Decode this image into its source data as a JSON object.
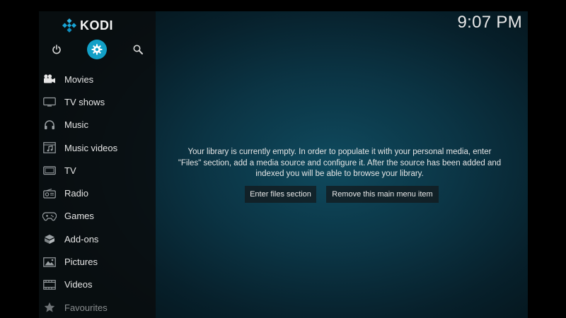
{
  "app": {
    "name": "KODI",
    "clock": "9:07 PM"
  },
  "top_buttons": [
    {
      "icon": "power-icon"
    },
    {
      "icon": "gear-icon",
      "active": true
    },
    {
      "icon": "search-icon"
    }
  ],
  "menu": {
    "items": [
      {
        "label": "Movies",
        "icon": "movie-camera-icon"
      },
      {
        "label": "TV shows",
        "icon": "tv-shows-icon"
      },
      {
        "label": "Music",
        "icon": "headphones-icon"
      },
      {
        "label": "Music videos",
        "icon": "music-video-icon"
      },
      {
        "label": "TV",
        "icon": "tv-icon"
      },
      {
        "label": "Radio",
        "icon": "radio-icon"
      },
      {
        "label": "Games",
        "icon": "gamepad-icon"
      },
      {
        "label": "Add-ons",
        "icon": "addons-box-icon"
      },
      {
        "label": "Pictures",
        "icon": "picture-icon"
      },
      {
        "label": "Videos",
        "icon": "film-strip-icon"
      },
      {
        "label": "Favourites",
        "icon": "star-icon"
      }
    ]
  },
  "main": {
    "message_line1": "Your library is currently empty. In order to populate it with your personal media, enter",
    "message_line2": "\"Files\" section, add a media source and configure it. After the source has been added and",
    "message_line3": "indexed you will be able to browse your library.",
    "enter_files_label": "Enter files section",
    "remove_item_label": "Remove this main menu item"
  },
  "colors": {
    "accent": "#12a0c7",
    "background": "#0b3444",
    "sidebar": "#0b0d0e",
    "text": "#e6e6e6"
  }
}
